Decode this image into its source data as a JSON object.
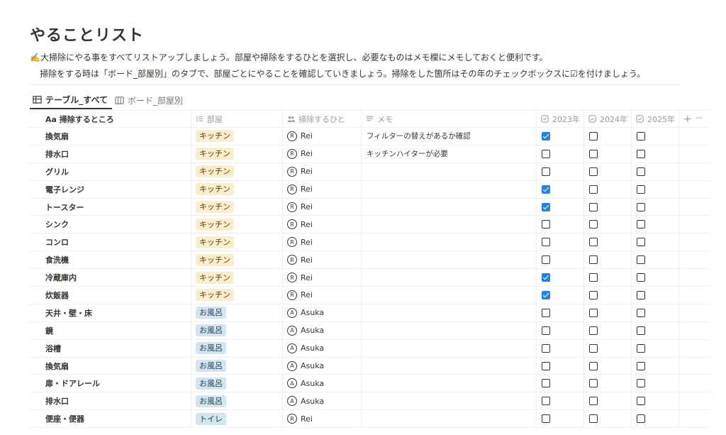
{
  "page": {
    "title": "やることリスト",
    "description_line1": "✍️大掃除にやる事をすべてリストアップしましょう。部屋や掃除をするひとを選択し、必要なものはメモ欄にメモしておくと便利です。",
    "description_line2": "掃除をする時は「ボード_部屋別」のタブで、部屋ごとにやることを確認していきましょう。掃除をした箇所はその年のチェックボックスに☑を付けましょう。"
  },
  "tabs": [
    {
      "label": "テーブル_すべて",
      "icon": "table-icon",
      "active": true
    },
    {
      "label": "ボード_部屋別",
      "icon": "board-icon",
      "active": false
    }
  ],
  "columns": {
    "name": "Aa 掃除するところ",
    "room": "部屋",
    "person": "掃除するひと",
    "memo": "メモ",
    "y2023": "2023年",
    "y2024": "2024年",
    "y2025": "2025年",
    "add": "+",
    "more": "···"
  },
  "tag_colors": {
    "キッチン": "#fbeecc",
    "お風呂": "#d3e5ef",
    "トイレ": "#d3e5ef"
  },
  "checkbox_color": "#2383e2",
  "rows": [
    {
      "name": "換気扇",
      "room": "キッチン",
      "room_class": "kitchen",
      "person": "Rei",
      "avatar": "R",
      "memo": "フィルターの替えがあるか確認",
      "y2023": true,
      "y2024": false,
      "y2025": false
    },
    {
      "name": "排水口",
      "room": "キッチン",
      "room_class": "kitchen",
      "person": "Rei",
      "avatar": "R",
      "memo": "キッチンハイターが必要",
      "y2023": false,
      "y2024": false,
      "y2025": false
    },
    {
      "name": "グリル",
      "room": "キッチン",
      "room_class": "kitchen",
      "person": "Rei",
      "avatar": "R",
      "memo": "",
      "y2023": false,
      "y2024": false,
      "y2025": false
    },
    {
      "name": "電子レンジ",
      "room": "キッチン",
      "room_class": "kitchen",
      "person": "Rei",
      "avatar": "R",
      "memo": "",
      "y2023": true,
      "y2024": false,
      "y2025": false
    },
    {
      "name": "トースター",
      "room": "キッチン",
      "room_class": "kitchen",
      "person": "Rei",
      "avatar": "R",
      "memo": "",
      "y2023": true,
      "y2024": false,
      "y2025": false
    },
    {
      "name": "シンク",
      "room": "キッチン",
      "room_class": "kitchen",
      "person": "Rei",
      "avatar": "R",
      "memo": "",
      "y2023": false,
      "y2024": false,
      "y2025": false
    },
    {
      "name": "コンロ",
      "room": "キッチン",
      "room_class": "kitchen",
      "person": "Rei",
      "avatar": "R",
      "memo": "",
      "y2023": false,
      "y2024": false,
      "y2025": false
    },
    {
      "name": "食洗機",
      "room": "キッチン",
      "room_class": "kitchen",
      "person": "Rei",
      "avatar": "R",
      "memo": "",
      "y2023": false,
      "y2024": false,
      "y2025": false
    },
    {
      "name": "冷蔵庫内",
      "room": "キッチン",
      "room_class": "kitchen",
      "person": "Rei",
      "avatar": "R",
      "memo": "",
      "y2023": true,
      "y2024": false,
      "y2025": false
    },
    {
      "name": "炊飯器",
      "room": "キッチン",
      "room_class": "kitchen",
      "person": "Rei",
      "avatar": "R",
      "memo": "",
      "y2023": true,
      "y2024": false,
      "y2025": false
    },
    {
      "name": "天井・壁・床",
      "room": "お風呂",
      "room_class": "bath",
      "person": "Asuka",
      "avatar": "A",
      "memo": "",
      "y2023": false,
      "y2024": false,
      "y2025": false
    },
    {
      "name": "鏡",
      "room": "お風呂",
      "room_class": "bath",
      "person": "Asuka",
      "avatar": "A",
      "memo": "",
      "y2023": false,
      "y2024": false,
      "y2025": false
    },
    {
      "name": "浴槽",
      "room": "お風呂",
      "room_class": "bath",
      "person": "Asuka",
      "avatar": "A",
      "memo": "",
      "y2023": false,
      "y2024": false,
      "y2025": false
    },
    {
      "name": "換気扇",
      "room": "お風呂",
      "room_class": "bath",
      "person": "Asuka",
      "avatar": "A",
      "memo": "",
      "y2023": false,
      "y2024": false,
      "y2025": false
    },
    {
      "name": "扉・ドアレール",
      "room": "お風呂",
      "room_class": "bath",
      "person": "Asuka",
      "avatar": "A",
      "memo": "",
      "y2023": false,
      "y2024": false,
      "y2025": false
    },
    {
      "name": "排水口",
      "room": "お風呂",
      "room_class": "bath",
      "person": "Asuka",
      "avatar": "A",
      "memo": "",
      "y2023": false,
      "y2024": false,
      "y2025": false
    },
    {
      "name": "便座・便器",
      "room": "トイレ",
      "room_class": "toilet",
      "person": "Rei",
      "avatar": "R",
      "memo": "",
      "y2023": false,
      "y2024": false,
      "y2025": false
    }
  ]
}
